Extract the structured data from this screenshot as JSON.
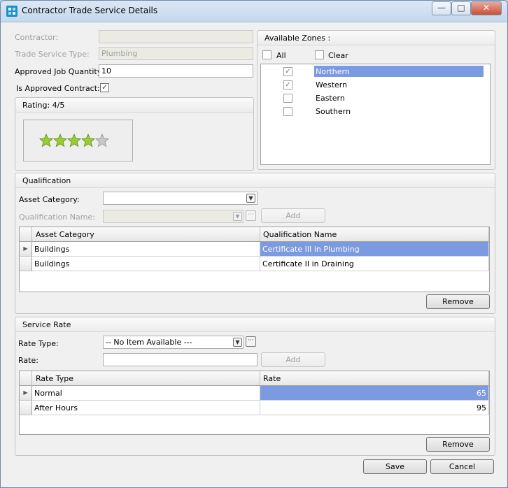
{
  "window": {
    "title": "Contractor Trade Service Details"
  },
  "form": {
    "contractor_label": "Contractor:",
    "contractor_value": "",
    "trade_service_label": "Trade Service Type:",
    "trade_service_value": "Plumbing",
    "approved_qty_label": "Approved Job Quantity:",
    "approved_qty_value": "10",
    "approved_contract_label": "Is Approved Contract:",
    "approved_contract_checked": true
  },
  "rating": {
    "title": "Rating: 4/5",
    "value": 4,
    "max": 5
  },
  "zones": {
    "title": "Available Zones :",
    "all_label": "All",
    "clear_label": "Clear",
    "items": [
      {
        "label": "Northern",
        "checked": true,
        "selected": true
      },
      {
        "label": "Western",
        "checked": true,
        "selected": false
      },
      {
        "label": "Eastern",
        "checked": false,
        "selected": false
      },
      {
        "label": "Southern",
        "checked": false,
        "selected": false
      }
    ]
  },
  "qualification": {
    "title": "Qualification",
    "asset_category_label": "Asset Category:",
    "asset_category_value": "",
    "qual_name_label": "Qualification Name:",
    "qual_name_value": "",
    "add_label": "Add",
    "remove_label": "Remove",
    "columns": [
      "Asset Category",
      "Qualification Name"
    ],
    "rows": [
      {
        "asset": "Buildings",
        "qualification": "Certificate III in Plumbing"
      },
      {
        "asset": "Buildings",
        "qualification": "Certificate II in Draining"
      }
    ]
  },
  "service_rate": {
    "title": "Service Rate",
    "rate_type_label": "Rate Type:",
    "rate_type_value": "-- No Item Available ---",
    "rate_label": "Rate:",
    "rate_value": "",
    "add_label": "Add",
    "remove_label": "Remove",
    "columns": [
      "Rate Type",
      "Rate"
    ],
    "rows": [
      {
        "type": "Normal",
        "rate": "65"
      },
      {
        "type": "After Hours",
        "rate": "95"
      }
    ]
  },
  "footer": {
    "save_label": "Save",
    "cancel_label": "Cancel"
  },
  "colors": {
    "selection": "#7b9ae0",
    "star_fill": "#9acd32",
    "star_empty": "#c8c8c8"
  }
}
